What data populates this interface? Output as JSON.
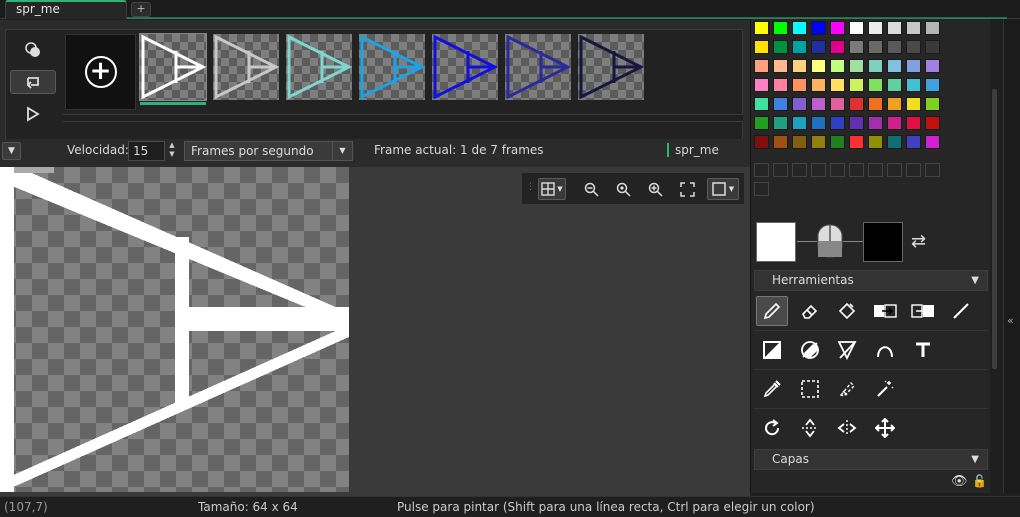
{
  "tabs": [
    {
      "label": "spr_me"
    }
  ],
  "tab_add_label": "+",
  "frames_count": 7,
  "speed": {
    "label": "Velocidad:",
    "value": "15",
    "unit_selected": "Frames por segundo"
  },
  "frame_status": "Frame actual: 1 de 7 frames",
  "sprite_name": "spr_me",
  "status": {
    "coords": "(107,7)",
    "size": "Tamaño: 64 x 64",
    "hint": "Pulse para pintar (Shift para una línea recta, Ctrl para elegir un color)"
  },
  "sections": {
    "tools": "Herramientas",
    "layers": "Capas"
  },
  "frame_colors": [
    "#ffffff",
    "#c8c8c8",
    "#7fd6cf",
    "#1aa3e6",
    "#1010e0",
    "#2a2a9a",
    "#16163e"
  ],
  "palette_rows": [
    [
      "#ffff00",
      "#00ff00",
      "#00ffff",
      "#0000ff",
      "#ff00ff",
      "#ffffff",
      "#ececec",
      "#dcdcdc",
      "#c8c8c8",
      "#b4b4b4"
    ],
    [
      "#ffe000",
      "#009040",
      "#00a4a0",
      "#2030a0",
      "#e0008a",
      "#7a7a7a",
      "#6a6a6a",
      "#5a5a5a",
      "#4a4a4a",
      "#3a3a3a"
    ],
    [
      "#ffa080",
      "#ffb890",
      "#ffd080",
      "#ffff80",
      "#c0ff80",
      "#a0e0a0",
      "#80d0c0",
      "#80c0e0",
      "#80a0e0",
      "#a080e0"
    ],
    [
      "#ff80c0",
      "#ff80a0",
      "#ff9060",
      "#ffb060",
      "#ffe060",
      "#d0f060",
      "#80e060",
      "#60d0a0",
      "#40c0d0",
      "#40a0e0"
    ],
    [
      "#40e0a0",
      "#4080e0",
      "#8060d0",
      "#c060d0",
      "#e060a0",
      "#e03030",
      "#f07020",
      "#f0a020",
      "#f0e020",
      "#80d020"
    ],
    [
      "#20a020",
      "#20a080",
      "#20a0c0",
      "#2070c0",
      "#3040c0",
      "#6030b0",
      "#a030b0",
      "#d02090",
      "#e01040",
      "#c01010"
    ],
    [
      "#801010",
      "#a05010",
      "#806010",
      "#908010",
      "#208020",
      "#ff3030",
      "#909000",
      "#107070",
      "#4040c0",
      "#d020d0"
    ]
  ],
  "icons": {
    "ctrl_1": "onion-skin-icon",
    "ctrl_2": "loop-icon",
    "ctrl_3": "play-icon",
    "zoom_buttons": [
      "grid-icon",
      "zoom-out-icon",
      "zoom-in-icon",
      "zoom-fit-icon",
      "fullscreen-icon",
      "background-icon"
    ]
  }
}
